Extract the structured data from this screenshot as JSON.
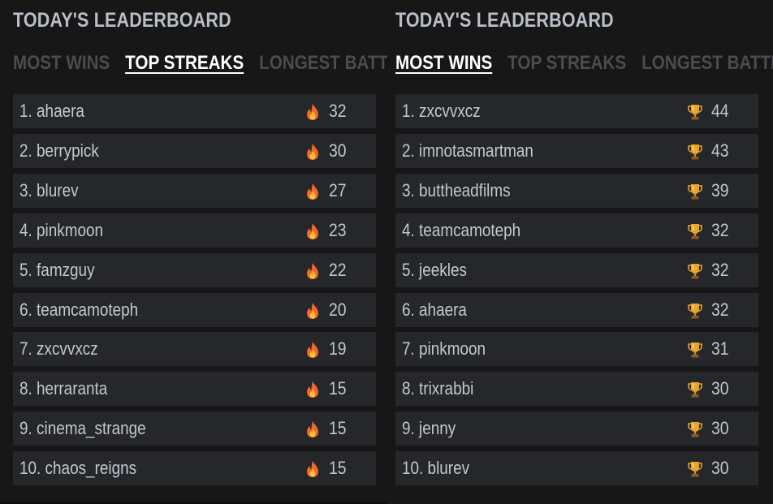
{
  "left": {
    "title": "TODAY'S LEADERBOARD",
    "tabs": [
      {
        "label": "MOST WINS",
        "active": false
      },
      {
        "label": "TOP STREAKS",
        "active": true
      },
      {
        "label": "LONGEST BATTLES",
        "active": false
      }
    ],
    "icon": "fire-icon",
    "rows": [
      {
        "label": "1. ahaera",
        "value": "32"
      },
      {
        "label": "2. berrypick",
        "value": "30"
      },
      {
        "label": "3. blurev",
        "value": "27"
      },
      {
        "label": "4. pinkmoon",
        "value": "23"
      },
      {
        "label": "5. famzguy",
        "value": "22"
      },
      {
        "label": "6. teamcamoteph",
        "value": "20"
      },
      {
        "label": "7. zxcvvxcz",
        "value": "19"
      },
      {
        "label": "8. herraranta",
        "value": "15"
      },
      {
        "label": "9. cinema_strange",
        "value": "15"
      },
      {
        "label": "10. chaos_reigns",
        "value": "15"
      }
    ]
  },
  "right": {
    "title": "TODAY'S LEADERBOARD",
    "tabs": [
      {
        "label": "MOST WINS",
        "active": true
      },
      {
        "label": "TOP STREAKS",
        "active": false
      },
      {
        "label": "LONGEST BATTLES",
        "active": false
      }
    ],
    "icon": "trophy-icon",
    "rows": [
      {
        "label": "1. zxcvvxcz",
        "value": "44"
      },
      {
        "label": "2. imnotasmartman",
        "value": "43"
      },
      {
        "label": "3. buttheadfilms",
        "value": "39"
      },
      {
        "label": "4. teamcamoteph",
        "value": "32"
      },
      {
        "label": "5. jeekles",
        "value": "32"
      },
      {
        "label": "6. ahaera",
        "value": "32"
      },
      {
        "label": "7. pinkmoon",
        "value": "31"
      },
      {
        "label": "8. trixrabbi",
        "value": "30"
      },
      {
        "label": "9. jenny",
        "value": "30"
      },
      {
        "label": "10. blurev",
        "value": "30"
      }
    ]
  },
  "colors": {
    "background": "#171717",
    "row": "#25272b",
    "tab_inactive": "#4a4c51",
    "tab_active": "#ffffff",
    "flame": "#f0682a",
    "trophy": "#e8a52c"
  }
}
